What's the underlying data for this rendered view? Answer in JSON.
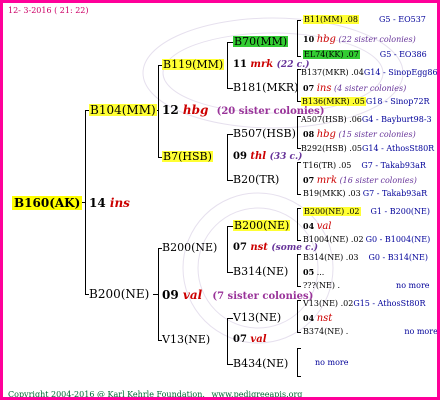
{
  "header": {
    "date": "12-  3-2016 ( 21: 22)"
  },
  "footer": {
    "copyright": "Copyright 2004-2016 @ Karl Kehrle Foundation.",
    "site": "www.pedigreeapis.org"
  },
  "colors": {
    "frame": "#ff0099",
    "yellow": "#ffff33",
    "green": "#33cc33",
    "race": "#cc0000",
    "info": "#000099"
  },
  "root": {
    "id": "B160(AK)",
    "year": "14",
    "race": "ins"
  },
  "gen1": [
    {
      "id": "B104(MM)",
      "year": "12",
      "race": "hbg",
      "siblings": "(20 sister colonies)"
    },
    {
      "id": "B200(NE)",
      "year": "09",
      "race": "val",
      "siblings": "(7 sister colonies)"
    }
  ],
  "gen2": [
    {
      "id": "B119(MM)",
      "year": "11",
      "race": "mrk",
      "siblings": "(22 c.)"
    },
    {
      "id": "B7(HSB)",
      "year": "09",
      "race": "thl",
      "siblings": "(33 c.)"
    },
    {
      "id": "B200(NE)",
      "year": "07",
      "race": "nst",
      "siblings": "(some c.)"
    },
    {
      "id": "V13(NE)",
      "year": "",
      "race": "",
      "siblings": ""
    }
  ],
  "gen3": [
    {
      "id": "B70(MM)"
    },
    {
      "id": "B181(MKR)"
    },
    {
      "id": "B507(HSB)"
    },
    {
      "id": "B20(TR)"
    },
    {
      "id": "B200(NE)"
    },
    {
      "id": "B314(NE)"
    },
    {
      "id": "V13(NE)",
      "year": "07",
      "race": "val"
    },
    {
      "id": "B434(NE)"
    }
  ],
  "gen4": [
    {
      "a": "B11(MM) .08",
      "b": "G5 - EO537"
    },
    {
      "a": "10",
      "race": "hbg",
      "c": "(22 sister colonies)"
    },
    {
      "a": "EL74(KK) .07",
      "b": "G5 - EO386"
    },
    {
      "a": "B137(MKR) .04",
      "b": "G14 - SinopEgg86R"
    },
    {
      "a": "07",
      "race": "ins",
      "c": "(4 sister colonies)"
    },
    {
      "a": "B136(MKR) .05",
      "b": "G18 - Sinop72R"
    },
    {
      "a": "A507(HSB) .06",
      "b": "G4 - Bayburt98-3"
    },
    {
      "a": "08",
      "race": "hbg",
      "c": "(15 sister colonies)"
    },
    {
      "a": "B292(HSB) .05",
      "b": "G14 - AthosSt80R"
    },
    {
      "a": "T16(TR) .05",
      "b": "G7 - Takab93aR"
    },
    {
      "a": "07",
      "race": "mrk",
      "c": "(16 sister colonies)"
    },
    {
      "a": "B19(MKK) .03",
      "b": "G7 - Takab93aR"
    },
    {
      "a": "B200(NE) .02",
      "b": "G1 - B200(NE)"
    },
    {
      "a": "04",
      "race": "val",
      "c": ""
    },
    {
      "a": "B1004(NE) .02",
      "b": "G0 - B1004(NE)"
    },
    {
      "a": "B314(NE) .03",
      "b": "G0 - B314(NE)"
    },
    {
      "a": "05",
      "race": "",
      "c": ""
    },
    {
      "a": "???(NE) .",
      "b": "no more"
    },
    {
      "a": "V13(NE) .02",
      "b": "G15 - AthosSt80R"
    },
    {
      "a": "04",
      "race": "nst",
      "c": ""
    },
    {
      "a": "B374(NE) .",
      "b": "no more"
    },
    {
      "a": "no more",
      "b": ""
    }
  ]
}
